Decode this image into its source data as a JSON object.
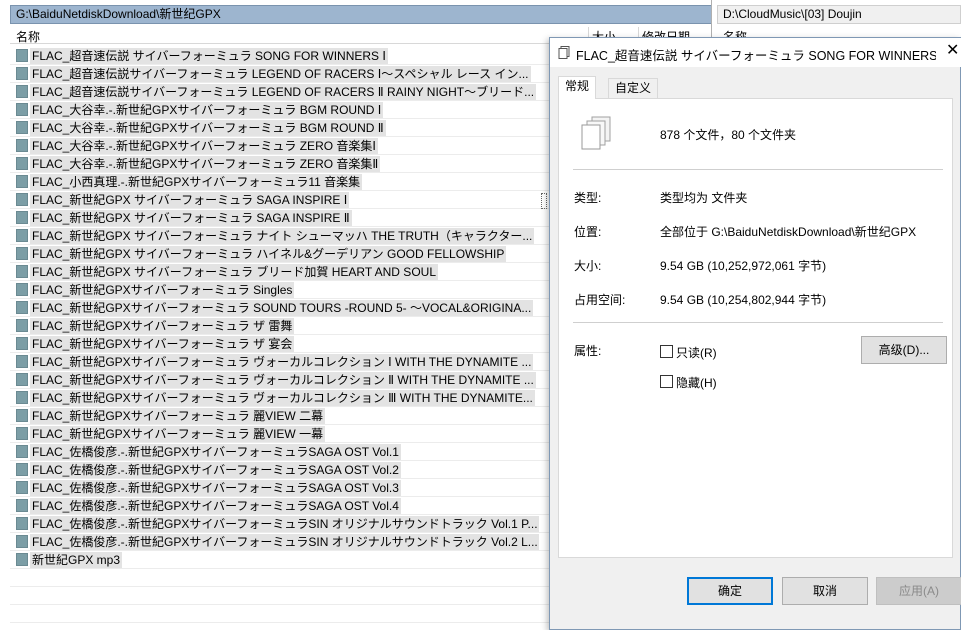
{
  "left_pane": {
    "path": "G:\\BaiduNetdiskDownload\\新世纪GPX",
    "col_name": "名称",
    "col_size": "大小",
    "col_date": "修改日期",
    "files": [
      "FLAC_超音速伝説 サイバーフォーミュラ SONG FOR WINNERS Ⅰ",
      "FLAC_超音速伝説サイバーフォーミュラ LEGEND OF RACERS Ⅰ～スペシャル レース イン...",
      "FLAC_超音速伝説サイバーフォーミュラ LEGEND OF RACERS Ⅱ RAINY NIGHT～ブリード...",
      "FLAC_大谷幸.-.新世紀GPXサイバーフォーミュラ BGM ROUND Ⅰ",
      "FLAC_大谷幸.-.新世紀GPXサイバーフォーミュラ BGM ROUND Ⅱ",
      "FLAC_大谷幸.-.新世紀GPXサイバーフォーミュラ ZERO 音楽集Ⅰ",
      "FLAC_大谷幸.-.新世紀GPXサイバーフォーミュラ ZERO 音楽集Ⅱ",
      "FLAC_小西真理.-.新世紀GPXサイバーフォーミュラ11 音楽集",
      "FLAC_新世紀GPX サイバーフォーミュラ SAGA INSPIRE Ⅰ",
      "FLAC_新世紀GPX サイバーフォーミュラ SAGA INSPIRE Ⅱ",
      "FLAC_新世紀GPX サイバーフォーミュラ ナイト シューマッハ THE TRUTH（キャラクター...",
      "FLAC_新世紀GPX サイバーフォーミュラ ハイネル&グーデリアン GOOD FELLOWSHIP",
      "FLAC_新世紀GPX サイバーフォーミュラ ブリード加賀 HEART AND SOUL",
      "FLAC_新世紀GPXサイバーフォーミュラ Singles",
      "FLAC_新世紀GPXサイバーフォーミュラ SOUND TOURS -ROUND 5- ～VOCAL&ORIGINA...",
      "FLAC_新世紀GPXサイバーフォーミュラ ザ 雷舞",
      "FLAC_新世紀GPXサイバーフォーミュラ ザ 宴会",
      "FLAC_新世紀GPXサイバーフォーミュラ ヴォーカルコレクション Ⅰ WITH THE DYNAMITE ...",
      "FLAC_新世紀GPXサイバーフォーミュラ ヴォーカルコレクション Ⅱ WITH THE DYNAMITE ...",
      "FLAC_新世紀GPXサイバーフォーミュラ ヴォーカルコレクション Ⅲ WITH THE DYNAMITE...",
      "FLAC_新世紀GPXサイバーフォーミュラ 麗VIEW 二幕",
      "FLAC_新世紀GPXサイバーフォーミュラ 麗VIEW 一幕",
      "FLAC_佐橋俊彦.-.新世紀GPXサイバーフォーミュラSAGA OST Vol.1",
      "FLAC_佐橋俊彦.-.新世紀GPXサイバーフォーミュラSAGA OST Vol.2",
      "FLAC_佐橋俊彦.-.新世紀GPXサイバーフォーミュラSAGA OST Vol.3",
      "FLAC_佐橋俊彦.-.新世紀GPXサイバーフォーミュラSAGA OST Vol.4",
      "FLAC_佐橋俊彦.-.新世紀GPXサイバーフォーミュラSIN オリジナルサウンドトラック Vol.1 P...",
      "FLAC_佐橋俊彦.-.新世紀GPXサイバーフォーミュラSIN オリジナルサウンドトラック Vol.2 L...",
      "新世紀GPX mp3"
    ]
  },
  "right_pane": {
    "path": "D:\\CloudMusic\\[03] Doujin",
    "col_name": "名称"
  },
  "dialog": {
    "title": "FLAC_超音速伝説 サイバーフォーミュラ SONG FOR WINNERS ...",
    "close": "✕",
    "tabs": [
      "常规",
      "自定义"
    ],
    "summary": "878 个文件，80 个文件夹",
    "type_label": "类型:",
    "type_value": "类型均为 文件夹",
    "location_label": "位置:",
    "location_value": "全部位于 G:\\BaiduNetdiskDownload\\新世纪GPX",
    "size_label": "大小:",
    "size_value": "9.54 GB (10,252,972,061 字节)",
    "disk_label": "占用空间:",
    "disk_value": "9.54 GB (10,254,802,944 字节)",
    "attr_label": "属性:",
    "readonly_label": "只读(R)",
    "hidden_label": "隐藏(H)",
    "advanced_label": "高级(D)...",
    "ok_label": "确定",
    "cancel_label": "取消",
    "apply_label": "应用(A)"
  },
  "colors": {
    "path_bar": "#9db5cf",
    "file_icon": "#7c9ea6",
    "accent": "#0078d7"
  }
}
